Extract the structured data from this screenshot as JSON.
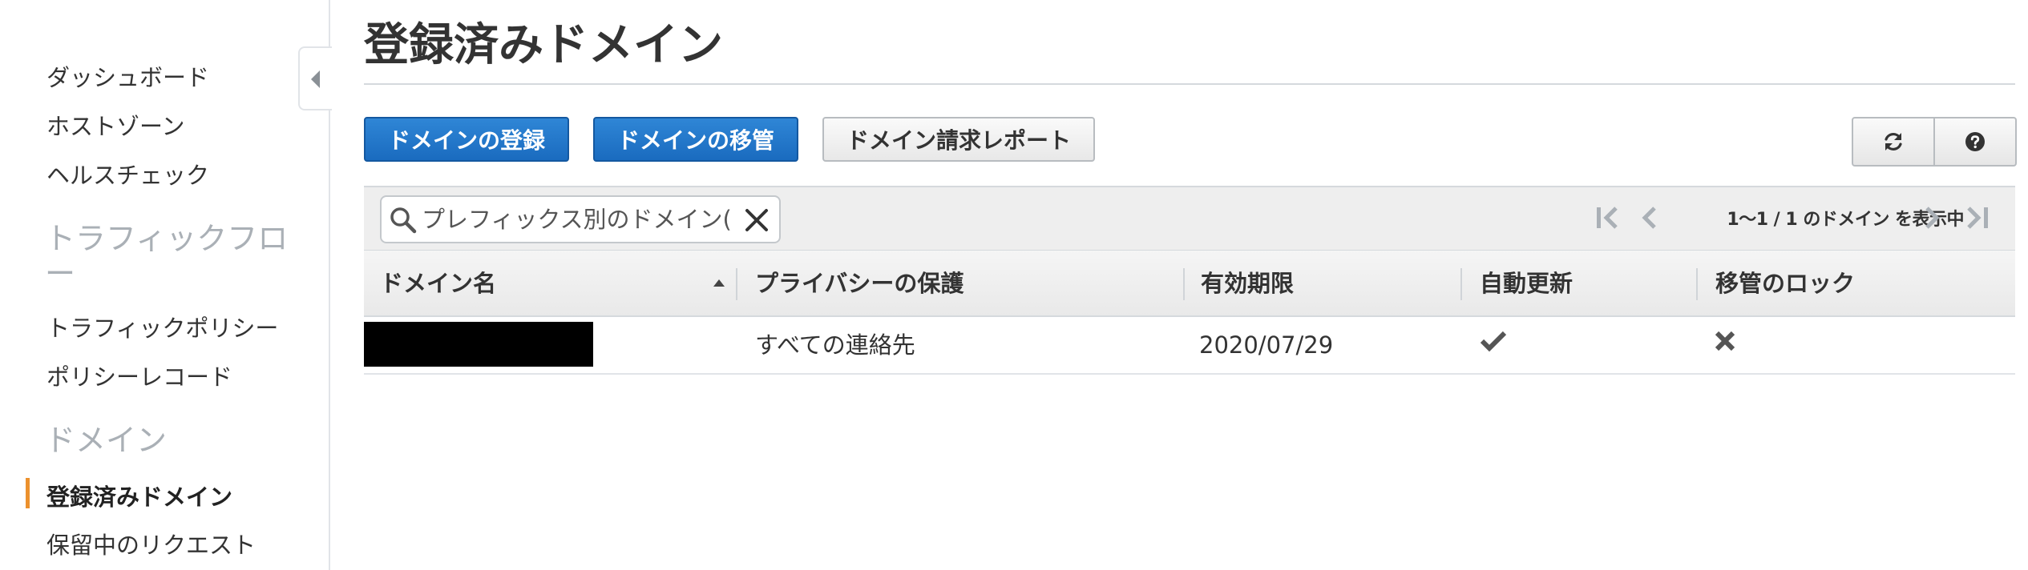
{
  "sidebar": {
    "items": [
      {
        "label": "ダッシュボード"
      },
      {
        "label": "ホストゾーン"
      },
      {
        "label": "ヘルスチェック"
      }
    ],
    "traffic_section": {
      "title_line1": "トラフィックフロ",
      "title_line2": "ー",
      "items": [
        {
          "label": "トラフィックポリシー"
        },
        {
          "label": "ポリシーレコード"
        }
      ]
    },
    "domain_section": {
      "title": "ドメイン",
      "items": [
        {
          "label": "登録済みドメイン",
          "active": true
        },
        {
          "label": "保留中のリクエスト"
        }
      ]
    }
  },
  "main": {
    "title": "登録済みドメイン",
    "buttons": {
      "register": "ドメインの登録",
      "transfer": "ドメインの移管",
      "billing_report": "ドメイン請求レポート"
    },
    "search": {
      "placeholder": "プレフィックス別のドメイン(",
      "value": ""
    },
    "pager": {
      "text": "1〜1 / 1 のドメイン を表示中"
    },
    "table": {
      "columns": [
        {
          "label": "ドメイン名",
          "sort": "asc"
        },
        {
          "label": "プライバシーの保護"
        },
        {
          "label": "有効期限"
        },
        {
          "label": "自動更新"
        },
        {
          "label": "移管のロック"
        }
      ],
      "rows": [
        {
          "domain_name": "",
          "privacy": "すべての連絡先",
          "expires": "2020/07/29",
          "auto_renew": "check-icon",
          "transfer_lock": "x-icon"
        }
      ]
    }
  },
  "colors": {
    "primary_button": "#1a6bbf",
    "active_indicator": "#ec912d",
    "section_heading": "#aab0b6"
  }
}
